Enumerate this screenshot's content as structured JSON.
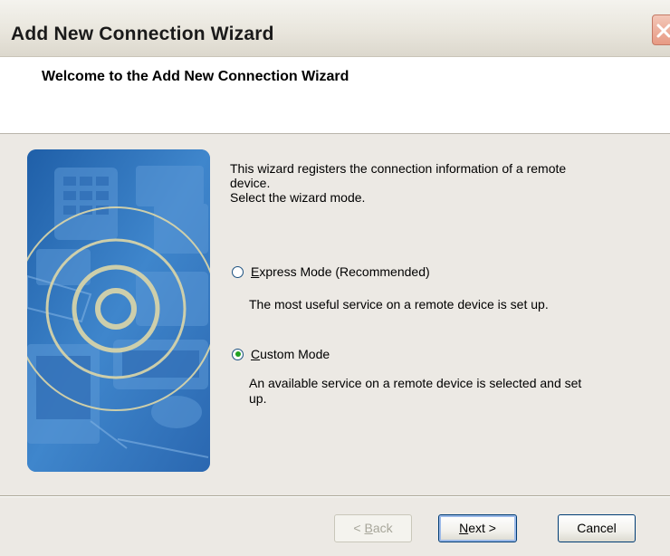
{
  "window": {
    "title": "Add New Connection Wizard"
  },
  "header": {
    "title": "Welcome to the Add New Connection Wizard"
  },
  "intro": {
    "line1": "This wizard registers the connection information of a remote",
    "line2": "device.",
    "line3": "Select the wizard mode."
  },
  "options": [
    {
      "label_accel": "E",
      "label_rest": "xpress Mode (Recommended)",
      "selected": false,
      "description": "The most useful service on a remote device is set up."
    },
    {
      "label_accel": "C",
      "label_rest": "ustom Mode",
      "selected": true,
      "description_line1": "An available service on a remote device is selected and set",
      "description_line2": "up."
    }
  ],
  "buttons": {
    "back_prefix": "< ",
    "back_accel": "B",
    "back_rest": "ack",
    "back_enabled": false,
    "next_accel": "N",
    "next_rest": "ext >",
    "cancel": "Cancel"
  },
  "colors": {
    "dialog_bg": "#ece9e4",
    "illustration_blue": "#3c7bc2",
    "radio_selected": "#21a121"
  }
}
